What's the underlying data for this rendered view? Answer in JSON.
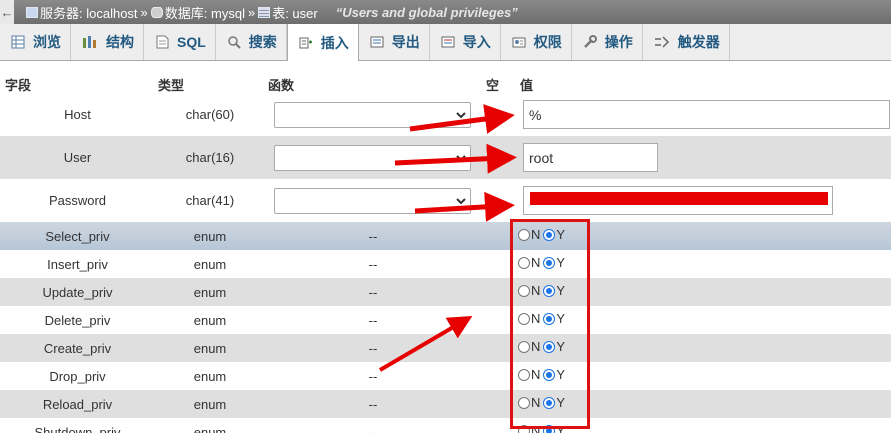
{
  "breadcrumb": {
    "back_glyph": "←",
    "server": "服务器: localhost",
    "database": "数据库: mysql",
    "table": "表: user",
    "separator": "»",
    "comment": "“Users and global privileges”"
  },
  "tabs": [
    {
      "label": "浏览",
      "icon": "browse-icon"
    },
    {
      "label": "结构",
      "icon": "structure-icon"
    },
    {
      "label": "SQL",
      "icon": "sql-icon"
    },
    {
      "label": "搜索",
      "icon": "search-icon"
    },
    {
      "label": "插入",
      "icon": "insert-icon",
      "active": true
    },
    {
      "label": "导出",
      "icon": "export-icon"
    },
    {
      "label": "导入",
      "icon": "import-icon"
    },
    {
      "label": "权限",
      "icon": "privileges-icon"
    },
    {
      "label": "操作",
      "icon": "operations-icon"
    },
    {
      "label": "触发器",
      "icon": "triggers-icon"
    }
  ],
  "columns": {
    "field": "字段",
    "type": "类型",
    "function": "函数",
    "null": "空",
    "value": "值"
  },
  "text_rows": [
    {
      "name": "Host",
      "type": "char(60)",
      "value": "%"
    },
    {
      "name": "User",
      "type": "char(16)",
      "value": "root"
    },
    {
      "name": "Password",
      "type": "char(41)",
      "value": ""
    }
  ],
  "enum_rows": [
    {
      "name": "Select_priv",
      "type": "enum",
      "func": "--",
      "selected": "Y"
    },
    {
      "name": "Insert_priv",
      "type": "enum",
      "func": "--",
      "selected": "Y"
    },
    {
      "name": "Update_priv",
      "type": "enum",
      "func": "--",
      "selected": "Y"
    },
    {
      "name": "Delete_priv",
      "type": "enum",
      "func": "--",
      "selected": "Y"
    },
    {
      "name": "Create_priv",
      "type": "enum",
      "func": "--",
      "selected": "Y"
    },
    {
      "name": "Drop_priv",
      "type": "enum",
      "func": "--",
      "selected": "Y"
    },
    {
      "name": "Reload_priv",
      "type": "enum",
      "func": "--",
      "selected": "Y"
    },
    {
      "name": "Shutdown_priv",
      "type": "enum",
      "func": "--",
      "selected": "Y"
    }
  ],
  "radio_labels": {
    "n": "N",
    "y": "Y"
  },
  "colors": {
    "accent": "#235a81",
    "annotation": "#e60000",
    "radio": "#1a73e8"
  }
}
